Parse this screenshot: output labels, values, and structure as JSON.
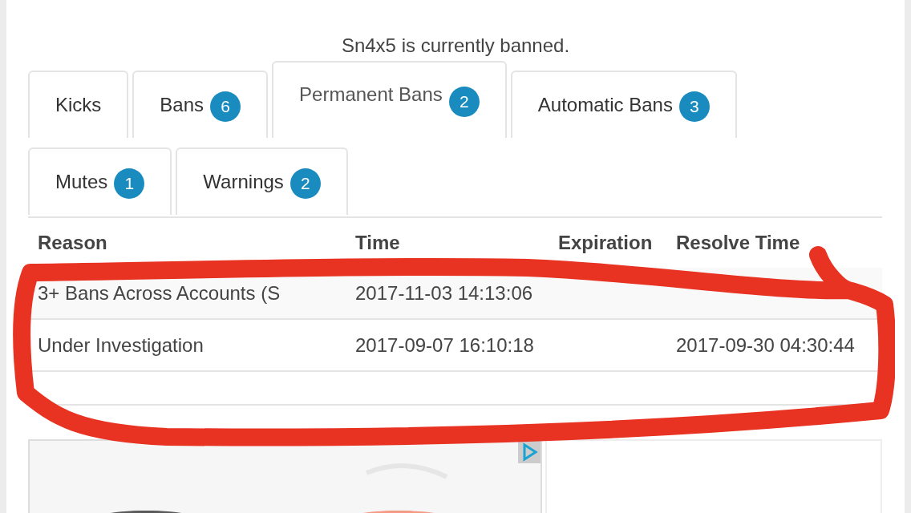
{
  "heading": "Sn4x5 is currently banned.",
  "tabs": [
    {
      "label": "Kicks",
      "selected": false
    },
    {
      "label": "Bans",
      "count": "6",
      "selected": false
    },
    {
      "label": "Permanent Bans",
      "count": "2",
      "selected": true
    },
    {
      "label": "Automatic Bans",
      "count": "3",
      "selected": false
    },
    {
      "label": "Mutes",
      "count": "1",
      "selected": false
    },
    {
      "label": "Warnings",
      "count": "2",
      "selected": false
    }
  ],
  "table": {
    "columns": [
      "Reason",
      "Time",
      "Expiration",
      "Resolve Time"
    ],
    "rows": [
      [
        "3+ Bans Across Accounts (S",
        "2017-11-03 14:13:06",
        "",
        ""
      ],
      [
        "Under Investigation",
        "2017-09-07 16:10:18",
        "",
        "2017-09-30 04:30:44"
      ]
    ]
  }
}
